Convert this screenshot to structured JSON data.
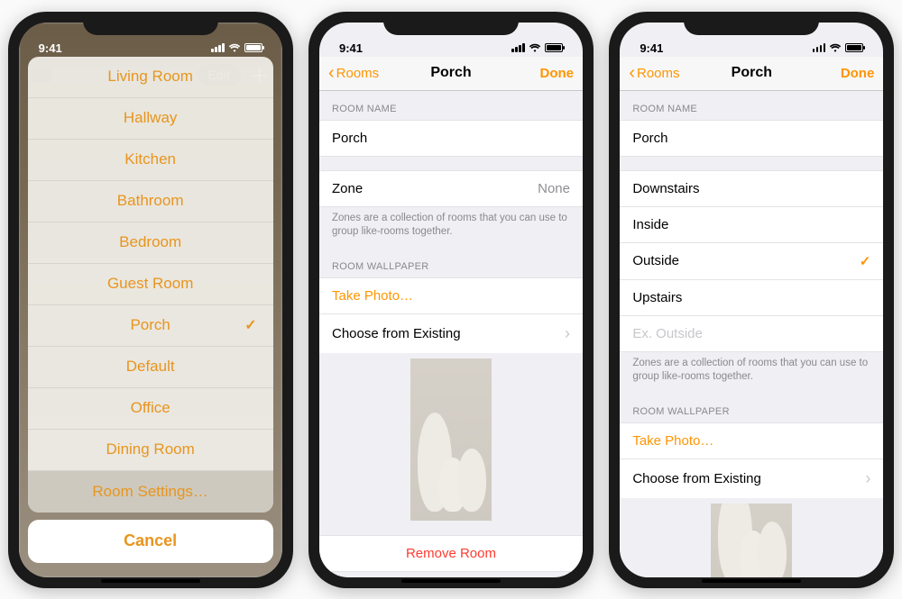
{
  "status_time": "9:41",
  "phone1": {
    "edit_label": "Edit",
    "rooms": [
      "Living Room",
      "Hallway",
      "Kitchen",
      "Bathroom",
      "Bedroom",
      "Guest Room",
      "Porch",
      "Default",
      "Office",
      "Dining Room"
    ],
    "selected_room": "Porch",
    "settings_label": "Room Settings…",
    "cancel_label": "Cancel"
  },
  "phone2": {
    "back_label": "Rooms",
    "title": "Porch",
    "done_label": "Done",
    "room_name_header": "ROOM NAME",
    "room_name_value": "Porch",
    "zone_label": "Zone",
    "zone_value": "None",
    "zone_footer": "Zones are a collection of rooms that you can use to group like-rooms together.",
    "wallpaper_header": "ROOM WALLPAPER",
    "take_photo_label": "Take Photo…",
    "choose_label": "Choose from Existing",
    "remove_label": "Remove Room"
  },
  "phone3": {
    "back_label": "Rooms",
    "title": "Porch",
    "done_label": "Done",
    "room_name_header": "ROOM NAME",
    "room_name_value": "Porch",
    "zones": [
      "Downstairs",
      "Inside",
      "Outside",
      "Upstairs"
    ],
    "selected_zone": "Outside",
    "zone_placeholder": "Ex. Outside",
    "zone_footer": "Zones are a collection of rooms that you can use to group like-rooms together.",
    "wallpaper_header": "ROOM WALLPAPER",
    "take_photo_label": "Take Photo…",
    "choose_label": "Choose from Existing"
  }
}
